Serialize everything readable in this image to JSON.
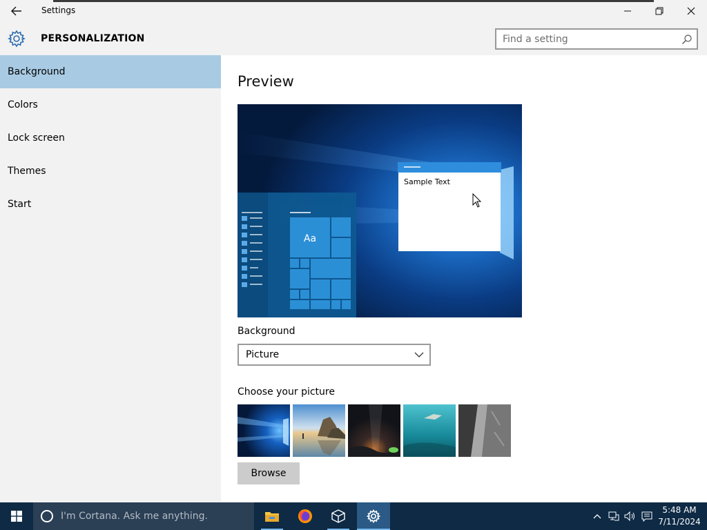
{
  "window": {
    "title": "Settings"
  },
  "header": {
    "section_title": "PERSONALIZATION",
    "search_placeholder": "Find a setting"
  },
  "sidebar": {
    "items": [
      {
        "label": "Background",
        "active": true
      },
      {
        "label": "Colors",
        "active": false
      },
      {
        "label": "Lock screen",
        "active": false
      },
      {
        "label": "Themes",
        "active": false
      },
      {
        "label": "Start",
        "active": false
      }
    ]
  },
  "main": {
    "preview_title": "Preview",
    "preview_sample_text": "Sample Text",
    "preview_tile_text": "Aa",
    "background_label": "Background",
    "background_value": "Picture",
    "choose_label": "Choose your picture",
    "browse_label": "Browse",
    "pictures": [
      {
        "name": "windows-hero"
      },
      {
        "name": "beach-rocks"
      },
      {
        "name": "night-sky"
      },
      {
        "name": "underwater-swimmer"
      },
      {
        "name": "rock-cliff"
      }
    ]
  },
  "taskbar": {
    "search_placeholder": "I'm Cortana. Ask me anything.",
    "apps": [
      {
        "name": "file-explorer-icon",
        "active": false
      },
      {
        "name": "firefox-icon",
        "active": false
      },
      {
        "name": "virtualbox-icon",
        "active": false
      },
      {
        "name": "settings-icon",
        "active": true
      }
    ],
    "time": "5:48 AM",
    "date": "7/11/2024"
  },
  "colors": {
    "accent": "#0078d7",
    "nav_selected": "#a8cbe3",
    "chrome_bg": "#f2f2f2",
    "taskbar_bg": "#0e2a45"
  }
}
